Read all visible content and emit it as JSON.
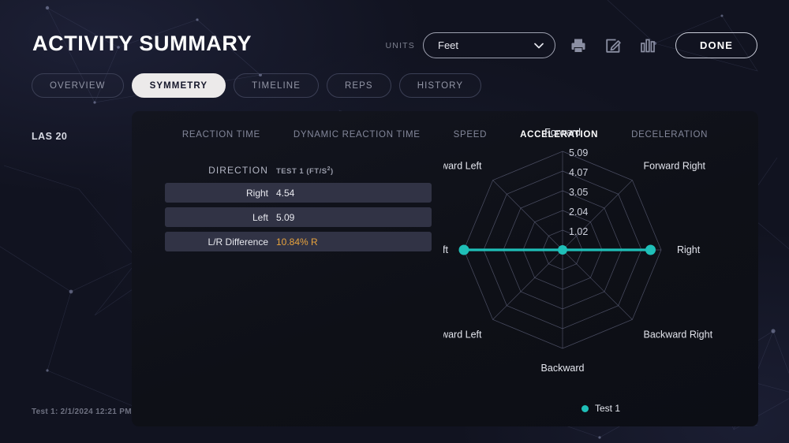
{
  "header": {
    "title": "ACTIVITY SUMMARY",
    "units_label": "UNITS",
    "units_value": "Feet",
    "print_icon": "print-icon",
    "edit_icon": "edit-icon",
    "chart_icon": "bar-chart-icon",
    "done_label": "DONE",
    "accent_color": "#1fbfb8",
    "warn_color": "#e8a33d"
  },
  "tabs": [
    {
      "label": "OVERVIEW",
      "active": false
    },
    {
      "label": "SYMMETRY",
      "active": true
    },
    {
      "label": "TIMELINE",
      "active": false
    },
    {
      "label": "REPS",
      "active": false
    },
    {
      "label": "HISTORY",
      "active": false
    }
  ],
  "rail": {
    "title": "LAS 20",
    "footer": "Test 1: 2/1/2024 12:21 PM"
  },
  "subtabs": [
    {
      "label": "REACTION TIME",
      "active": false
    },
    {
      "label": "DYNAMIC REACTION TIME",
      "active": false
    },
    {
      "label": "SPEED",
      "active": false
    },
    {
      "label": "ACCELERATION",
      "active": true
    },
    {
      "label": "DECELERATION",
      "active": false
    }
  ],
  "table": {
    "col_direction": "DIRECTION",
    "col_test": "TEST 1 (FT/S",
    "col_test_sup": "2",
    "col_test_suffix": ")",
    "rows": [
      {
        "label": "Right",
        "value": "4.54",
        "warn": false
      },
      {
        "label": "Left",
        "value": "5.09",
        "warn": false
      },
      {
        "label": "L/R Difference",
        "value": "10.84% R",
        "warn": true
      }
    ]
  },
  "chart_data": {
    "type": "radar",
    "title": "",
    "categories": [
      "Forward",
      "Forward Right",
      "Right",
      "Backward Right",
      "Backward",
      "Backward Left",
      "Left",
      "Forward Left"
    ],
    "rings": [
      "1.02",
      "2.04",
      "3.05",
      "4.07",
      "5.09"
    ],
    "ring_values": [
      1.02,
      2.04,
      3.05,
      4.07,
      5.09
    ],
    "rmax": 5.09,
    "series": [
      {
        "name": "Test 1",
        "color": "#1fbfb8",
        "values": [
          null,
          null,
          4.54,
          null,
          null,
          null,
          5.09,
          null
        ]
      }
    ],
    "legend": [
      {
        "label": "Test 1",
        "color": "#1fbfb8"
      }
    ],
    "legend_position": "bottom",
    "grid": true
  }
}
